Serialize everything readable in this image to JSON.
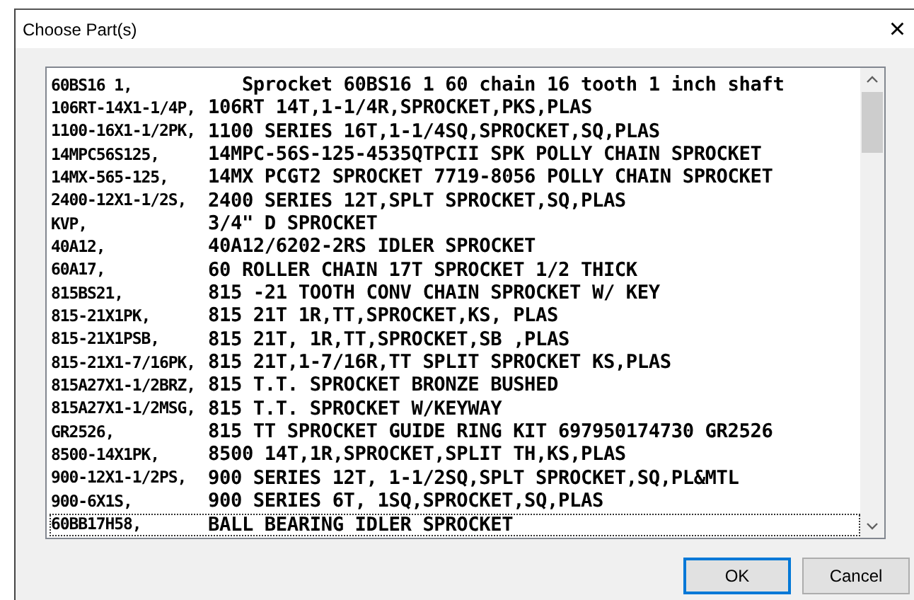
{
  "window": {
    "title": "Choose Part(s)",
    "close": "×"
  },
  "parts": [
    {
      "code": "60BS16 1,",
      "description": "   Sprocket 60BS16 1 60 chain 16 tooth 1 inch shaft",
      "focused": false
    },
    {
      "code": "106RT-14X1-1/4P,",
      "description": "106RT 14T,1-1/4R,SPROCKET,PKS,PLAS",
      "focused": false
    },
    {
      "code": "1100-16X1-1/2PK,",
      "description": "1100 SERIES 16T,1-1/4SQ,SPROCKET,SQ,PLAS",
      "focused": false
    },
    {
      "code": "14MPC56S125,",
      "description": "14MPC-56S-125-4535QTPCII SPK POLLY CHAIN SPROCKET",
      "focused": false
    },
    {
      "code": "14MX-565-125,",
      "description": "14MX PCGT2 SPROCKET 7719-8056 POLLY CHAIN SPROCKET",
      "focused": false
    },
    {
      "code": "2400-12X1-1/2S,",
      "description": "2400 SERIES 12T,SPLT SPROCKET,SQ,PLAS",
      "focused": false
    },
    {
      "code": "KVP,",
      "description": "3/4\" D SPROCKET",
      "focused": false
    },
    {
      "code": "40A12,",
      "description": "40A12/6202-2RS IDLER SPROCKET",
      "focused": false
    },
    {
      "code": "60A17,",
      "description": "60 ROLLER CHAIN 17T SPROCKET 1/2 THICK",
      "focused": false
    },
    {
      "code": "815BS21,",
      "description": "815 -21 TOOTH CONV CHAIN SPROCKET W/ KEY",
      "focused": false
    },
    {
      "code": "815-21X1PK,",
      "description": "815 21T 1R,TT,SPROCKET,KS, PLAS",
      "focused": false
    },
    {
      "code": "815-21X1PSB,",
      "description": "815 21T, 1R,TT,SPROCKET,SB ,PLAS",
      "focused": false
    },
    {
      "code": "815-21X1-7/16PK,",
      "description": "815 21T,1-7/16R,TT SPLIT SPROCKET KS,PLAS",
      "focused": false
    },
    {
      "code": "815A27X1-1/2BRZ,",
      "description": "815 T.T. SPROCKET BRONZE BUSHED",
      "focused": false
    },
    {
      "code": "815A27X1-1/2MSG,",
      "description": "815 T.T. SPROCKET W/KEYWAY",
      "focused": false
    },
    {
      "code": "GR2526,",
      "description": "815 TT SPROCKET GUIDE RING KIT 697950174730 GR2526",
      "focused": false
    },
    {
      "code": "8500-14X1PK,",
      "description": "8500 14T,1R,SPROCKET,SPLIT TH,KS,PLAS",
      "focused": false
    },
    {
      "code": "900-12X1-1/2PS,",
      "description": "900 SERIES 12T, 1-1/2SQ,SPLT SPROCKET,SQ,PL&MTL",
      "focused": false
    },
    {
      "code": "900-6X1S,",
      "description": "900 SERIES 6T, 1SQ,SPROCKET,SQ,PLAS",
      "focused": false
    },
    {
      "code": "60BB17H58,",
      "description": "BALL BEARING IDLER SPROCKET",
      "focused": true
    }
  ],
  "buttons": [
    {
      "label": "OK",
      "default": true
    },
    {
      "label": "Cancel",
      "default": false
    }
  ]
}
